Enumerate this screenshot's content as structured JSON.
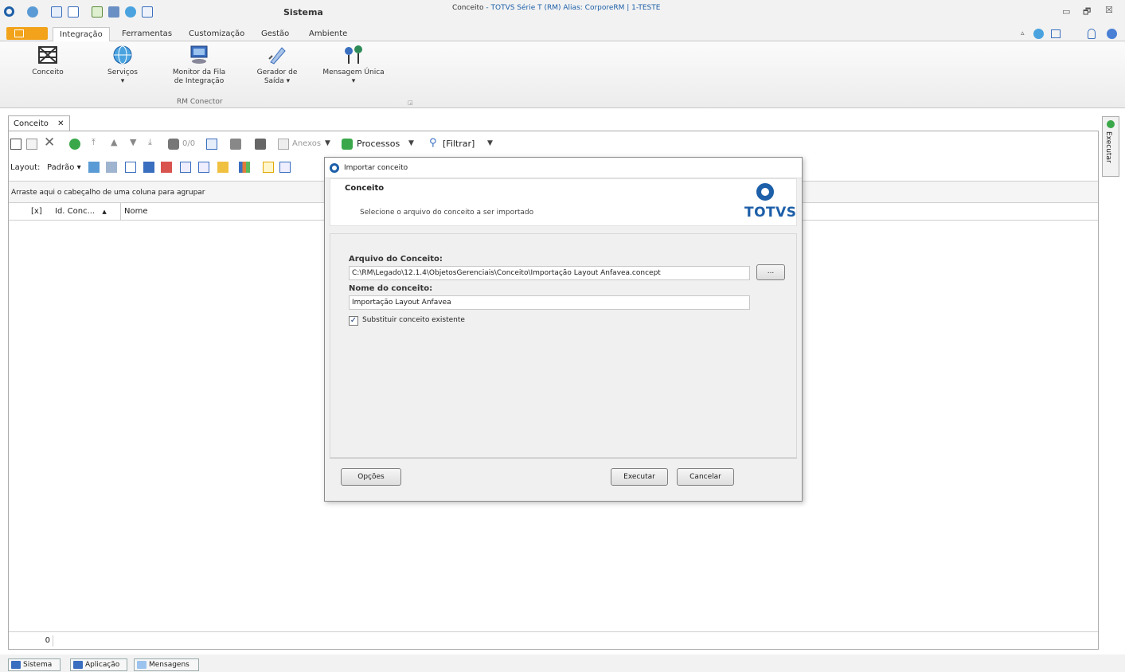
{
  "window": {
    "system_label": "Sistema",
    "title_main": "Conceito",
    "title_sub": " - TOTVS Série T  (RM) Alias: CorporeRM | 1-TESTE",
    "min_glyph": "▭",
    "restore_glyph": "🗗",
    "close_glyph": "☒"
  },
  "ribbon": {
    "tabs": [
      "Integração",
      "Ferramentas",
      "Customização",
      "Gestão",
      "Ambiente"
    ],
    "buttons": {
      "conceito": "Conceito",
      "servicos": "Serviços",
      "monitor_l1": "Monitor da Fila",
      "monitor_l2": "de Integração",
      "gerador_l1": "Gerador de",
      "gerador_l2": "Saída ▾",
      "mensagem": "Mensagem Única",
      "dropdown": "▾"
    },
    "group_label": "RM Conector",
    "right_icons": [
      "up-icon",
      "help-icon",
      "layout-icon",
      "bulb-icon",
      "info-icon"
    ]
  },
  "doc": {
    "tab_label": "Conceito",
    "tab_close": "✕"
  },
  "toolbar": {
    "counter": "0/0",
    "anexos": "Anexos",
    "processos": "Processos",
    "filtrar": "[Filtrar]",
    "layout_label": "Layout:",
    "layout_value": "Padrão"
  },
  "grid": {
    "group_hint": "Arraste aqui o cabeçalho de uma coluna para agrupar",
    "col_x": "[x]",
    "col_id": "Id. Conc...",
    "sort_glyph": "▲",
    "col_nome": "Nome",
    "footer_count": "0"
  },
  "sidebar": {
    "executar": "Executar"
  },
  "statusbar": {
    "sistema": "Sistema",
    "aplicacao": "Aplicação",
    "mensagens": "Mensagens"
  },
  "dialog": {
    "title": "Importar conceito",
    "header_title": "Conceito",
    "header_desc": "Selecione o arquivo do conceito a ser importado",
    "brand": "TOTVS",
    "file_label": "Arquivo do Conceito:",
    "file_value": "C:\\RM\\Legado\\12.1.4\\ObjetosGerenciais\\Conceito\\Importação Layout Anfavea.concept",
    "browse": "...",
    "name_label": "Nome do conceito:",
    "name_value": "Importação Layout Anfavea",
    "replace_label": "Substituir conceito existente",
    "replace_checked": true,
    "opcoes": "Opções",
    "executar": "Executar",
    "cancelar": "Cancelar"
  },
  "colors": {
    "accent": "#f2a31b",
    "brand_blue": "#1d5fa8",
    "label_text": "#333333"
  }
}
